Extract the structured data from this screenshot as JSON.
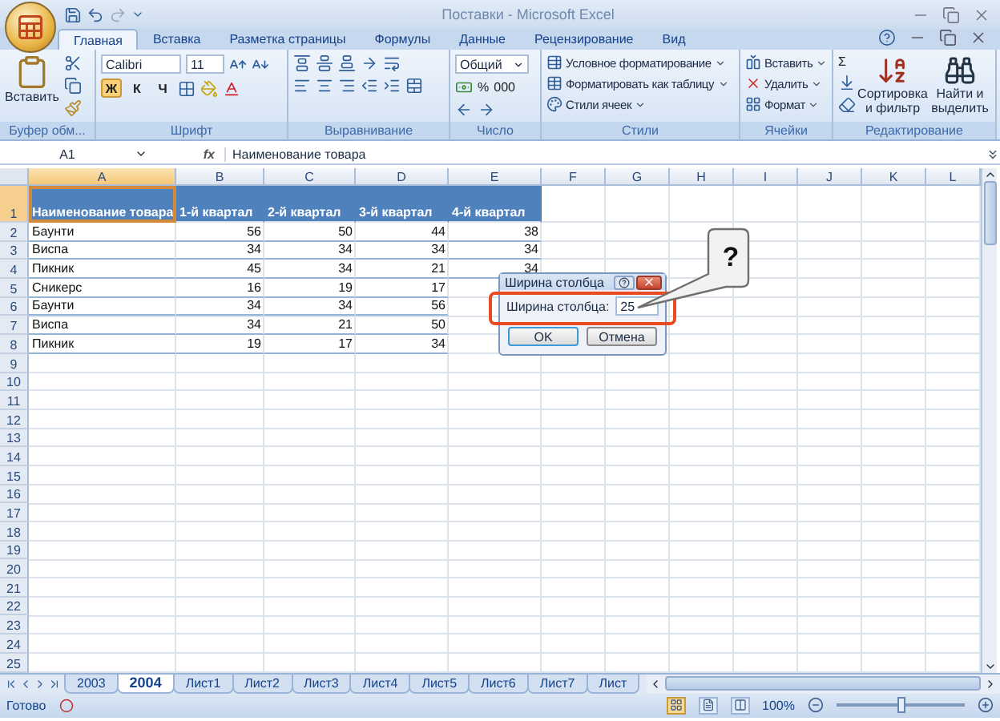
{
  "window": {
    "title": "Поставки - Microsoft Excel"
  },
  "tabs": [
    {
      "label": "Главная",
      "selected": true
    },
    {
      "label": "Вставка",
      "selected": false
    },
    {
      "label": "Разметка страницы",
      "selected": false
    },
    {
      "label": "Формулы",
      "selected": false
    },
    {
      "label": "Данные",
      "selected": false
    },
    {
      "label": "Рецензирование",
      "selected": false
    },
    {
      "label": "Вид",
      "selected": false
    }
  ],
  "ribbon": [
    {
      "kind": "clipboard",
      "label": "Буфер обм...",
      "paste": "Вставить"
    },
    {
      "kind": "font",
      "label": "Шрифт",
      "font": "Calibri",
      "size": "11",
      "styles": [
        {
          "label": "Ж",
          "on": true
        },
        {
          "label": "К",
          "on": false
        },
        {
          "label": "Ч",
          "on": false
        }
      ]
    },
    {
      "kind": "alignment",
      "label": "Выравнивание"
    },
    {
      "kind": "number",
      "label": "Число",
      "format": "Общий",
      "symbols": [
        "%",
        "000"
      ]
    },
    {
      "kind": "styles",
      "label": "Стили",
      "items": [
        "Условное форматирование",
        "Форматировать как таблицу",
        "Стили ячеек"
      ]
    },
    {
      "kind": "cells",
      "label": "Ячейки",
      "items": [
        "Вставить",
        "Удалить",
        "Формат"
      ]
    },
    {
      "kind": "editing",
      "label": "Редактирование",
      "sigma": "Σ",
      "items": [
        "Сортировка и фильтр",
        "Найти и выделить"
      ]
    }
  ],
  "formula_bar": {
    "name_box": "A1",
    "fx": "fx",
    "formula": "Наименование товара"
  },
  "columns": [
    {
      "label": "A",
      "selected": true
    },
    {
      "label": "B",
      "selected": false
    },
    {
      "label": "C",
      "selected": false
    },
    {
      "label": "D",
      "selected": false
    },
    {
      "label": "E",
      "selected": false
    },
    {
      "label": "F",
      "selected": false
    },
    {
      "label": "G",
      "selected": false
    },
    {
      "label": "H",
      "selected": false
    },
    {
      "label": "I",
      "selected": false
    },
    {
      "label": "J",
      "selected": false
    },
    {
      "label": "K",
      "selected": false
    },
    {
      "label": "L",
      "selected": false
    }
  ],
  "rows": [
    {
      "number": "1",
      "kind": "header",
      "selected": true,
      "cells": [
        "Наименование товара",
        "1-й квартал",
        "2-й квартал",
        "3-й квартал",
        "4-й квартал"
      ]
    },
    {
      "number": "2",
      "kind": "data",
      "selected": false,
      "cells": [
        "Баунти",
        "56",
        "50",
        "44",
        "38"
      ]
    },
    {
      "number": "3",
      "kind": "data",
      "selected": false,
      "cells": [
        "Виспа",
        "34",
        "34",
        "34",
        "34"
      ]
    },
    {
      "number": "4",
      "kind": "data",
      "selected": false,
      "cells": [
        "Пикник",
        "45",
        "34",
        "21",
        "34"
      ]
    },
    {
      "number": "5",
      "kind": "data",
      "selected": false,
      "cells": [
        "Сникерс",
        "16",
        "19",
        "17",
        null
      ]
    },
    {
      "number": "6",
      "kind": "data",
      "selected": false,
      "cells": [
        "Баунти",
        "34",
        "34",
        "56",
        null
      ]
    },
    {
      "number": "7",
      "kind": "data",
      "selected": false,
      "cells": [
        "Виспа",
        "34",
        "21",
        "50",
        null
      ]
    },
    {
      "number": "8",
      "kind": "data",
      "selected": false,
      "cells": [
        "Пикник",
        "19",
        "17",
        "34",
        null
      ]
    },
    {
      "number": "9",
      "kind": "empty",
      "selected": false
    },
    {
      "number": "10",
      "kind": "empty",
      "selected": false
    },
    {
      "number": "11",
      "kind": "empty",
      "selected": false
    },
    {
      "number": "12",
      "kind": "empty",
      "selected": false
    },
    {
      "number": "13",
      "kind": "empty",
      "selected": false
    },
    {
      "number": "14",
      "kind": "empty",
      "selected": false
    },
    {
      "number": "15",
      "kind": "empty",
      "selected": false
    },
    {
      "number": "16",
      "kind": "empty",
      "selected": false
    },
    {
      "number": "17",
      "kind": "empty",
      "selected": false
    },
    {
      "number": "18",
      "kind": "empty",
      "selected": false
    },
    {
      "number": "19",
      "kind": "empty",
      "selected": false
    },
    {
      "number": "20",
      "kind": "empty",
      "selected": false
    },
    {
      "number": "21",
      "kind": "empty",
      "selected": false
    },
    {
      "number": "22",
      "kind": "empty",
      "selected": false
    },
    {
      "number": "23",
      "kind": "empty",
      "selected": false
    },
    {
      "number": "24",
      "kind": "empty",
      "selected": false
    },
    {
      "number": "25",
      "kind": "empty",
      "selected": false
    }
  ],
  "dialog": {
    "title": "Ширина столбца",
    "label": "Ширина столбца:",
    "value": "25",
    "buttons": [
      "OK",
      "Отмена"
    ]
  },
  "callout": {
    "text": "?"
  },
  "sheet_tabs": [
    {
      "label": "2003",
      "selected": false
    },
    {
      "label": "2004",
      "selected": true
    },
    {
      "label": "Лист1",
      "selected": false
    },
    {
      "label": "Лист2",
      "selected": false
    },
    {
      "label": "Лист3",
      "selected": false
    },
    {
      "label": "Лист4",
      "selected": false
    },
    {
      "label": "Лист5",
      "selected": false
    },
    {
      "label": "Лист6",
      "selected": false
    },
    {
      "label": "Лист7",
      "selected": false
    },
    {
      "label": "Лист",
      "selected": false
    }
  ],
  "status_bar": {
    "text": "Готово",
    "views": [
      {
        "selected": true
      },
      {
        "selected": false
      },
      {
        "selected": false
      }
    ],
    "zoom": "100%",
    "zoom_slider": {
      "level": 0.5
    }
  }
}
